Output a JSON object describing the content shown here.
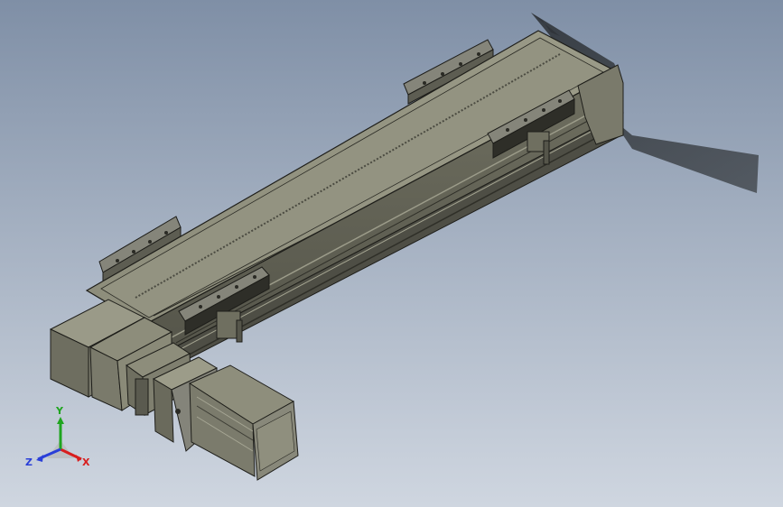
{
  "view": {
    "background_top": "#7f8fa6",
    "background_bottom": "#cfd6e0",
    "model_face_color": "#8a8a78",
    "model_edge_color": "#1e1e1a"
  },
  "triad": {
    "x_label": "X",
    "y_label": "Y",
    "z_label": "Z",
    "x_color": "#d81e1e",
    "y_color": "#1fa51f",
    "z_color": "#2a3fd8"
  }
}
